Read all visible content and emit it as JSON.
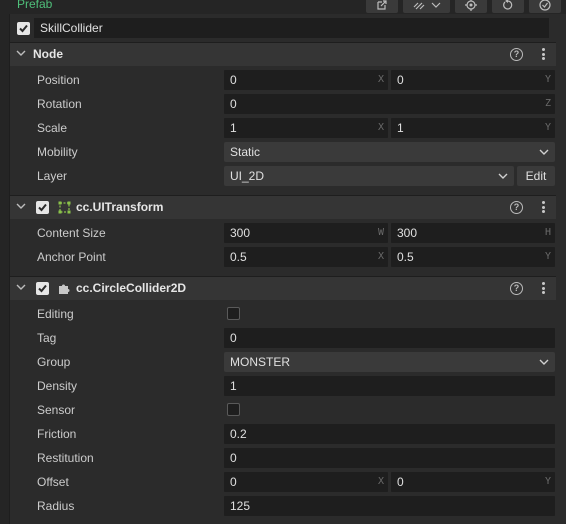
{
  "header": {
    "prefab_label": "Prefab",
    "toolbar_icons": [
      "open-external-icon",
      "link-settings-icon",
      "locate-icon",
      "revert-icon",
      "apply-icon"
    ]
  },
  "node_name": {
    "enabled": true,
    "value": "SkillCollider"
  },
  "node": {
    "title": "Node",
    "position": {
      "label": "Position",
      "x": "0",
      "x_axis": "X",
      "y": "0",
      "y_axis": "Y"
    },
    "rotation": {
      "label": "Rotation",
      "z": "0",
      "z_axis": "Z"
    },
    "scale": {
      "label": "Scale",
      "x": "1",
      "x_axis": "X",
      "y": "1",
      "y_axis": "Y"
    },
    "mobility": {
      "label": "Mobility",
      "value": "Static"
    },
    "layer": {
      "label": "Layer",
      "value": "UI_2D",
      "edit_label": "Edit"
    }
  },
  "ui_transform": {
    "title": "cc.UITransform",
    "enabled": true,
    "content_size": {
      "label": "Content Size",
      "w": "300",
      "w_axis": "W",
      "h": "300",
      "h_axis": "H"
    },
    "anchor_point": {
      "label": "Anchor Point",
      "x": "0.5",
      "x_axis": "X",
      "y": "0.5",
      "y_axis": "Y"
    }
  },
  "circle_collider": {
    "title": "cc.CircleCollider2D",
    "enabled": true,
    "editing": {
      "label": "Editing",
      "checked": false
    },
    "tag": {
      "label": "Tag",
      "value": "0"
    },
    "group": {
      "label": "Group",
      "value": "MONSTER"
    },
    "density": {
      "label": "Density",
      "value": "1"
    },
    "sensor": {
      "label": "Sensor",
      "checked": false
    },
    "friction": {
      "label": "Friction",
      "value": "0.2"
    },
    "restitution": {
      "label": "Restitution",
      "value": "0"
    },
    "offset": {
      "label": "Offset",
      "x": "0",
      "x_axis": "X",
      "y": "0",
      "y_axis": "Y"
    },
    "radius": {
      "label": "Radius",
      "value": "125"
    }
  },
  "colors": {
    "background": "#2b2b2b",
    "field": "#1e1e1e",
    "section_header": "#353535",
    "prefab_green": "#4fbf7a",
    "transform_icon": "#8bc34a"
  }
}
